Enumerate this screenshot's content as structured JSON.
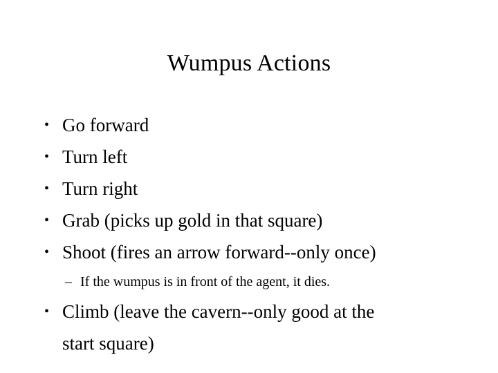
{
  "slide": {
    "title": "Wumpus Actions",
    "bullet_glyph": "•",
    "dash_glyph": "–",
    "items": [
      {
        "text": "Go forward"
      },
      {
        "text": "Turn left"
      },
      {
        "text": "Turn right"
      },
      {
        "text": "Grab (picks up gold in that square)"
      },
      {
        "text": "Shoot (fires an arrow forward--only once)"
      }
    ],
    "sub_items": [
      {
        "text": "If the wumpus is in front of the agent, it dies."
      }
    ],
    "final_item": {
      "line1": "Climb (leave the cavern--only good at the",
      "line2": "start square)"
    }
  }
}
